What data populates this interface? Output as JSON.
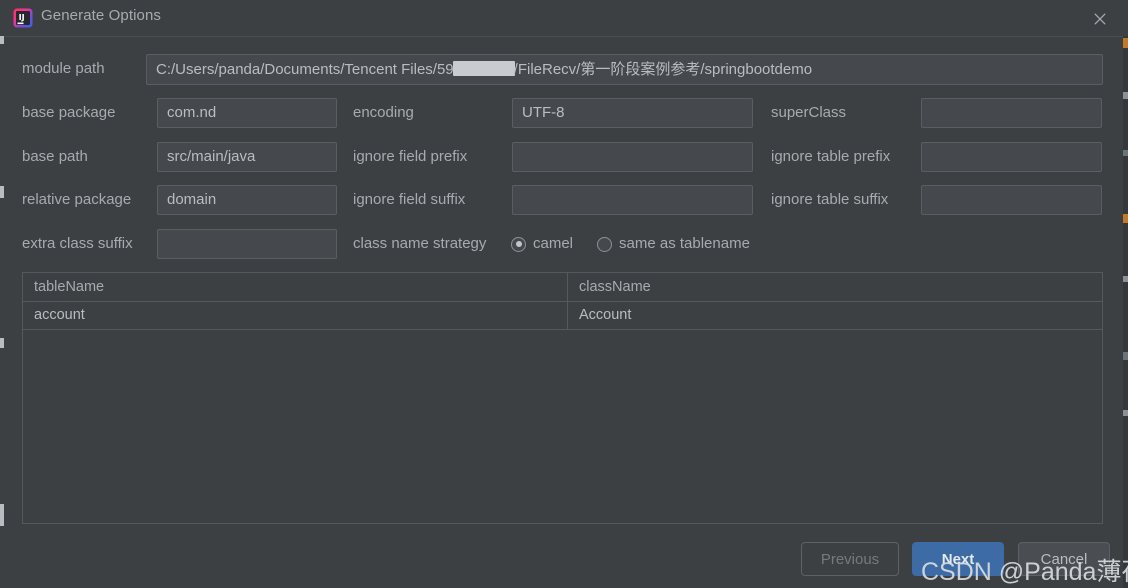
{
  "window": {
    "title": "Generate Options",
    "app_icon": "intellij-idea-icon",
    "close_icon": "close-icon"
  },
  "form": {
    "module_path": {
      "label": "module path",
      "value_before": "C:/Users/panda/Documents/Tencent Files/59",
      "value_redacted": "██████",
      "value_after": "/FileRecv/第一阶段案例参考/springbootdemo"
    },
    "fields": [
      {
        "label": "base package",
        "value": "com.nd",
        "placeholder": ""
      },
      {
        "label": "encoding",
        "value": "UTF-8",
        "placeholder": ""
      },
      {
        "label": "superClass",
        "value": "",
        "placeholder": ""
      },
      {
        "label": "base path",
        "value": "src/main/java",
        "placeholder": ""
      },
      {
        "label": "ignore field prefix",
        "value": "",
        "placeholder": ""
      },
      {
        "label": "ignore table prefix",
        "value": "",
        "placeholder": ""
      },
      {
        "label": "relative package",
        "value": "domain",
        "placeholder": ""
      },
      {
        "label": "ignore field suffix",
        "value": "",
        "placeholder": ""
      },
      {
        "label": "ignore table suffix",
        "value": "",
        "placeholder": ""
      },
      {
        "label": "extra class suffix",
        "value": "",
        "placeholder": ""
      }
    ],
    "class_name_strategy": {
      "label": "class name strategy",
      "options": [
        {
          "label": "camel",
          "selected": true
        },
        {
          "label": "same as tablename",
          "selected": false
        }
      ]
    }
  },
  "table": {
    "columns": [
      "tableName",
      "className"
    ],
    "rows": [
      {
        "tableName": "account",
        "className": "Account"
      }
    ]
  },
  "buttons": {
    "previous": "Previous",
    "next": "Next",
    "cancel": "Cancel"
  },
  "watermark": "CSDN @Panda薄荷糖",
  "colors": {
    "background": "#3c4043",
    "field_background": "#45494d",
    "border": "#5a5e62",
    "text": "#a7abb0",
    "value_text": "#b9bcc0",
    "primary_button": "#3c6ba5",
    "disabled_text": "#76797d"
  }
}
